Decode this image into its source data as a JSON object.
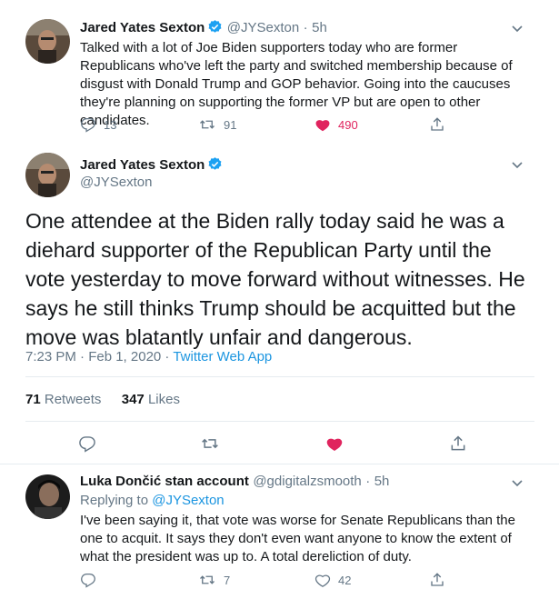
{
  "tweet1": {
    "name": "Jared Yates Sexton",
    "handle": "@JYSexton",
    "time": "5h",
    "text": "Talked with a lot of Joe Biden supporters today who are former Republicans who've left the party and switched membership because of disgust with Donald Trump and GOP behavior. Going into the caucuses they're planning on supporting the former VP but are open to other candidates.",
    "replies": "13",
    "retweets": "91",
    "likes": "490"
  },
  "tweet2": {
    "name": "Jared Yates Sexton",
    "handle": "@JYSexton",
    "text": "One attendee at the Biden rally today said he was a diehard supporter of the Republican Party until the vote yesterday to move forward without witnesses. He says he still thinks Trump should be acquitted but the move was blatantly unfair and dangerous.",
    "timestamp": "7:23 PM · Feb 1, 2020 · ",
    "source": "Twitter Web App",
    "retweets_count": "71",
    "retweets_label": "Retweets",
    "likes_count": "347",
    "likes_label": "Likes"
  },
  "tweet3": {
    "name": "Luka Dončić stan account",
    "handle": "@gdigitalzsmooth",
    "time": "5h",
    "replying_prefix": "Replying to ",
    "replying_to": "@JYSexton",
    "text": "I've been saying it, that vote was worse for Senate Republicans than the one to acquit. It says they don't even want anyone to know the extent of what the president was up to. A total dereliction of duty.",
    "retweets": "7",
    "likes": "42"
  },
  "colors": {
    "accent": "#1da1f2",
    "like": "#e0245e",
    "muted": "#657786",
    "divider": "#e6ecf0"
  },
  "icons": [
    "reply-icon",
    "retweet-icon",
    "like-icon",
    "share-icon",
    "verified-badge-icon",
    "chevron-down-icon"
  ]
}
